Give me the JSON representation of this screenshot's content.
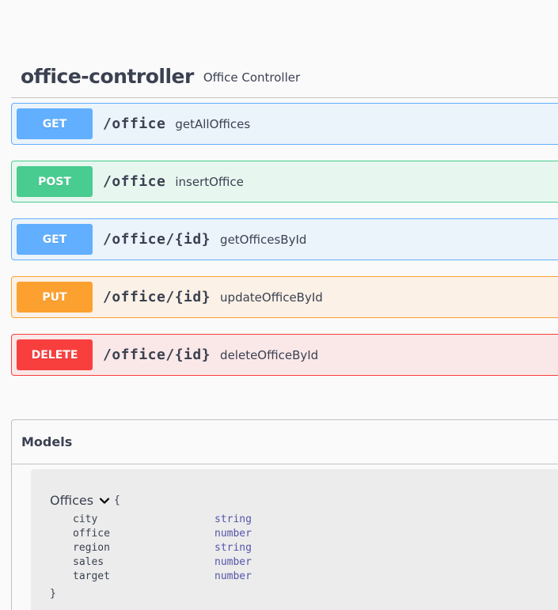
{
  "controller": {
    "title": "office-controller",
    "description": "Office Controller"
  },
  "operations": [
    {
      "method": "GET",
      "path": "/office",
      "summary": "getAllOffices"
    },
    {
      "method": "POST",
      "path": "/office",
      "summary": "insertOffice"
    },
    {
      "method": "GET",
      "path": "/office/{id}",
      "summary": "getOfficesById"
    },
    {
      "method": "PUT",
      "path": "/office/{id}",
      "summary": "updateOfficeById"
    },
    {
      "method": "DELETE",
      "path": "/office/{id}",
      "summary": "deleteOfficeById"
    }
  ],
  "colors": {
    "get": "#61affe",
    "post": "#49cc90",
    "put": "#fca130",
    "delete": "#f93e3e"
  },
  "models": {
    "title": "Models",
    "model": {
      "name": "Offices",
      "open_brace": "{",
      "close_brace": "}",
      "icon": "chevron-down-icon",
      "properties": [
        {
          "name": "city",
          "type": "string"
        },
        {
          "name": "office",
          "type": "number"
        },
        {
          "name": "region",
          "type": "string"
        },
        {
          "name": "sales",
          "type": "number"
        },
        {
          "name": "target",
          "type": "number"
        }
      ]
    }
  }
}
